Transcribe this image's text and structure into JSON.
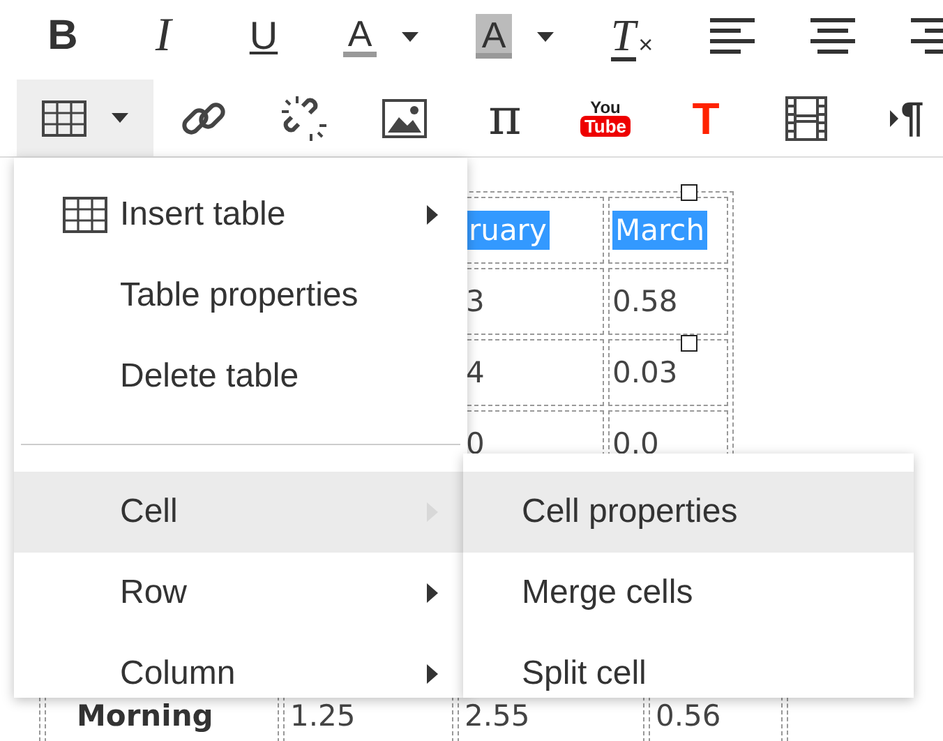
{
  "toolbar": {
    "rows": [
      [
        {
          "kind": "bold",
          "glyph": "B",
          "dropdown": false,
          "selected": false
        },
        {
          "kind": "italic",
          "glyph": "I",
          "dropdown": false,
          "selected": false
        },
        {
          "kind": "underline",
          "glyph": "U",
          "dropdown": false,
          "selected": false
        },
        {
          "kind": "text-color",
          "glyph": "A",
          "dropdown": true,
          "selected": false
        },
        {
          "kind": "background-color",
          "glyph": "A",
          "dropdown": true,
          "selected": false
        },
        {
          "kind": "clear-format",
          "glyph": "T",
          "sub": "×",
          "dropdown": false,
          "selected": false
        },
        {
          "kind": "align-left",
          "dropdown": false,
          "selected": false
        },
        {
          "kind": "align-center",
          "dropdown": false,
          "selected": false
        },
        {
          "kind": "align-right",
          "dropdown": false,
          "selected": false
        }
      ],
      [
        {
          "kind": "table",
          "dropdown": true,
          "selected": true
        },
        {
          "kind": "link",
          "dropdown": false,
          "selected": false
        },
        {
          "kind": "unlink",
          "dropdown": false,
          "selected": false
        },
        {
          "kind": "image",
          "dropdown": false,
          "selected": false
        },
        {
          "kind": "math",
          "glyph": "π",
          "dropdown": false,
          "selected": false
        },
        {
          "kind": "youtube",
          "glyph": "You",
          "sub": "Tube",
          "dropdown": false,
          "selected": false
        },
        {
          "kind": "text-style",
          "glyph": "T",
          "dropdown": false,
          "selected": false
        },
        {
          "kind": "video",
          "dropdown": false,
          "selected": false
        },
        {
          "kind": "paragraph",
          "glyph": "¶",
          "dropdown": false,
          "selected": false
        }
      ]
    ]
  },
  "document_table": {
    "top_rows": [
      [
        {
          "text": "ruary",
          "selected": true
        },
        {
          "text": "March",
          "selected": true
        }
      ],
      [
        {
          "text": "3",
          "selected": false
        },
        {
          "text": "0.58",
          "selected": false
        }
      ],
      [
        {
          "text": "4",
          "selected": false
        },
        {
          "text": "0.03",
          "selected": false
        }
      ],
      [
        {
          "text": "0",
          "selected": false
        },
        {
          "text": "0.0",
          "selected": false
        }
      ]
    ],
    "bottom_row": [
      "Morning",
      "1.25",
      "2.55",
      "0.56"
    ]
  },
  "table_menu": {
    "items": [
      {
        "kind": "icon-item",
        "label": "Insert table",
        "submenu": true,
        "selected": false
      },
      {
        "kind": "item",
        "label": "Table properties",
        "submenu": false,
        "selected": false
      },
      {
        "kind": "item",
        "label": "Delete table",
        "submenu": false,
        "selected": false
      },
      {
        "kind": "separator"
      },
      {
        "kind": "item",
        "label": "Cell",
        "submenu": true,
        "selected": true
      },
      {
        "kind": "item",
        "label": "Row",
        "submenu": true,
        "selected": false
      },
      {
        "kind": "item",
        "label": "Column",
        "submenu": true,
        "selected": false
      }
    ]
  },
  "cell_submenu": {
    "items": [
      {
        "label": "Cell properties",
        "selected": true
      },
      {
        "label": "Merge cells",
        "selected": false
      },
      {
        "label": "Split cell",
        "selected": false
      }
    ]
  }
}
